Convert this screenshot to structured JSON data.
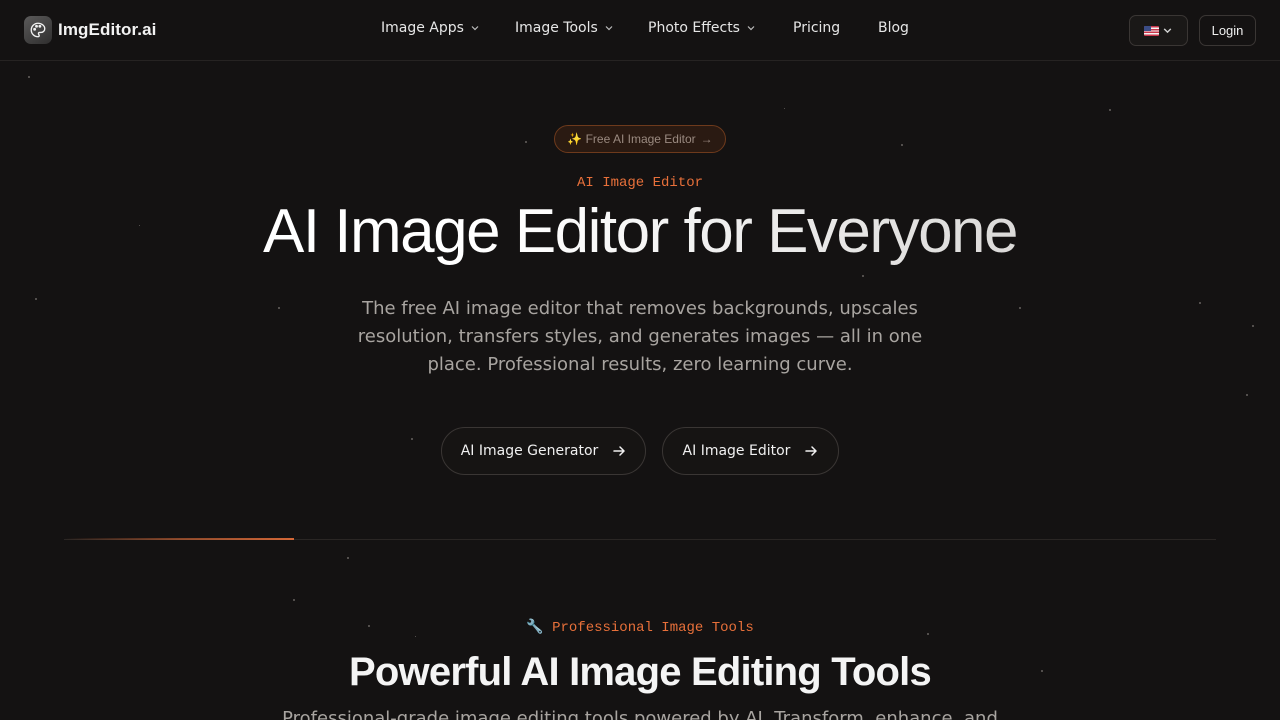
{
  "brand": {
    "name": "ImgEditor.ai",
    "logo_icon": "palette-icon"
  },
  "nav": {
    "items": [
      {
        "label": "Image Apps",
        "has_dropdown": true
      },
      {
        "label": "Image Tools",
        "has_dropdown": true
      },
      {
        "label": "Photo Effects",
        "has_dropdown": true
      },
      {
        "label": "Pricing",
        "has_dropdown": false
      },
      {
        "label": "Blog",
        "has_dropdown": false
      }
    ],
    "language_flag": "us-flag-icon",
    "login_label": "Login"
  },
  "hero": {
    "badge": "✨ Free AI Image Editor",
    "badge_arrow": "→",
    "eyebrow": "AI Image Editor",
    "title": "AI Image Editor for Everyone",
    "subtitle": "The free AI image editor that removes backgrounds, upscales resolution, transfers styles, and generates images — all in one place. Professional results, zero learning curve.",
    "buttons": [
      {
        "label": "AI Image Generator",
        "icon": "arrow-right-icon"
      },
      {
        "label": "AI Image Editor",
        "icon": "arrow-right-icon"
      }
    ]
  },
  "tools_section": {
    "eyebrow_icon": "🔧",
    "eyebrow": "Professional Image Tools",
    "title": "Powerful AI Image Editing Tools",
    "subtitle": "Professional-grade image editing tools powered by AI. Transform, enhance, and"
  },
  "colors": {
    "background": "#141212",
    "accent": "#e8703a",
    "text": "#ededed",
    "muted_text": "#a8a4a0",
    "border": "#3a3634"
  }
}
